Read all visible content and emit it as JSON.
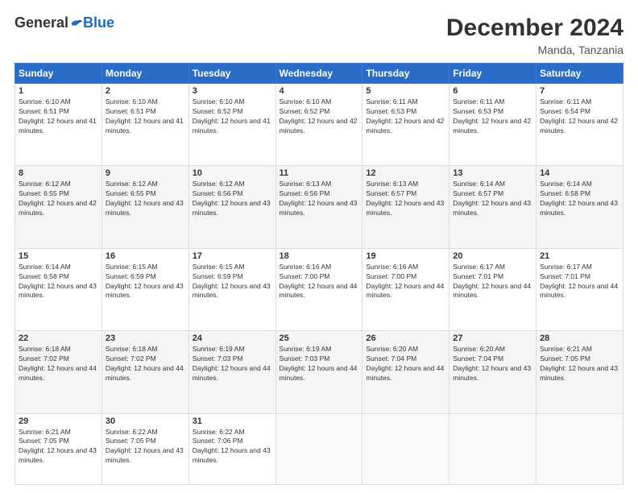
{
  "header": {
    "logo_general": "General",
    "logo_blue": "Blue",
    "month": "December 2024",
    "location": "Manda, Tanzania"
  },
  "weekdays": [
    "Sunday",
    "Monday",
    "Tuesday",
    "Wednesday",
    "Thursday",
    "Friday",
    "Saturday"
  ],
  "weeks": [
    [
      {
        "day": "1",
        "sunrise": "6:10 AM",
        "sunset": "6:51 PM",
        "daylight": "12 hours and 41 minutes."
      },
      {
        "day": "2",
        "sunrise": "6:10 AM",
        "sunset": "6:51 PM",
        "daylight": "12 hours and 41 minutes."
      },
      {
        "day": "3",
        "sunrise": "6:10 AM",
        "sunset": "6:52 PM",
        "daylight": "12 hours and 41 minutes."
      },
      {
        "day": "4",
        "sunrise": "6:10 AM",
        "sunset": "6:52 PM",
        "daylight": "12 hours and 42 minutes."
      },
      {
        "day": "5",
        "sunrise": "6:11 AM",
        "sunset": "6:53 PM",
        "daylight": "12 hours and 42 minutes."
      },
      {
        "day": "6",
        "sunrise": "6:11 AM",
        "sunset": "6:53 PM",
        "daylight": "12 hours and 42 minutes."
      },
      {
        "day": "7",
        "sunrise": "6:11 AM",
        "sunset": "6:54 PM",
        "daylight": "12 hours and 42 minutes."
      }
    ],
    [
      {
        "day": "8",
        "sunrise": "6:12 AM",
        "sunset": "6:55 PM",
        "daylight": "12 hours and 42 minutes."
      },
      {
        "day": "9",
        "sunrise": "6:12 AM",
        "sunset": "6:55 PM",
        "daylight": "12 hours and 43 minutes."
      },
      {
        "day": "10",
        "sunrise": "6:12 AM",
        "sunset": "6:56 PM",
        "daylight": "12 hours and 43 minutes."
      },
      {
        "day": "11",
        "sunrise": "6:13 AM",
        "sunset": "6:56 PM",
        "daylight": "12 hours and 43 minutes."
      },
      {
        "day": "12",
        "sunrise": "6:13 AM",
        "sunset": "6:57 PM",
        "daylight": "12 hours and 43 minutes."
      },
      {
        "day": "13",
        "sunrise": "6:14 AM",
        "sunset": "6:57 PM",
        "daylight": "12 hours and 43 minutes."
      },
      {
        "day": "14",
        "sunrise": "6:14 AM",
        "sunset": "6:58 PM",
        "daylight": "12 hours and 43 minutes."
      }
    ],
    [
      {
        "day": "15",
        "sunrise": "6:14 AM",
        "sunset": "6:58 PM",
        "daylight": "12 hours and 43 minutes."
      },
      {
        "day": "16",
        "sunrise": "6:15 AM",
        "sunset": "6:59 PM",
        "daylight": "12 hours and 43 minutes."
      },
      {
        "day": "17",
        "sunrise": "6:15 AM",
        "sunset": "6:59 PM",
        "daylight": "12 hours and 43 minutes."
      },
      {
        "day": "18",
        "sunrise": "6:16 AM",
        "sunset": "7:00 PM",
        "daylight": "12 hours and 44 minutes."
      },
      {
        "day": "19",
        "sunrise": "6:16 AM",
        "sunset": "7:00 PM",
        "daylight": "12 hours and 44 minutes."
      },
      {
        "day": "20",
        "sunrise": "6:17 AM",
        "sunset": "7:01 PM",
        "daylight": "12 hours and 44 minutes."
      },
      {
        "day": "21",
        "sunrise": "6:17 AM",
        "sunset": "7:01 PM",
        "daylight": "12 hours and 44 minutes."
      }
    ],
    [
      {
        "day": "22",
        "sunrise": "6:18 AM",
        "sunset": "7:02 PM",
        "daylight": "12 hours and 44 minutes."
      },
      {
        "day": "23",
        "sunrise": "6:18 AM",
        "sunset": "7:02 PM",
        "daylight": "12 hours and 44 minutes."
      },
      {
        "day": "24",
        "sunrise": "6:19 AM",
        "sunset": "7:03 PM",
        "daylight": "12 hours and 44 minutes."
      },
      {
        "day": "25",
        "sunrise": "6:19 AM",
        "sunset": "7:03 PM",
        "daylight": "12 hours and 44 minutes."
      },
      {
        "day": "26",
        "sunrise": "6:20 AM",
        "sunset": "7:04 PM",
        "daylight": "12 hours and 44 minutes."
      },
      {
        "day": "27",
        "sunrise": "6:20 AM",
        "sunset": "7:04 PM",
        "daylight": "12 hours and 43 minutes."
      },
      {
        "day": "28",
        "sunrise": "6:21 AM",
        "sunset": "7:05 PM",
        "daylight": "12 hours and 43 minutes."
      }
    ],
    [
      {
        "day": "29",
        "sunrise": "6:21 AM",
        "sunset": "7:05 PM",
        "daylight": "12 hours and 43 minutes."
      },
      {
        "day": "30",
        "sunrise": "6:22 AM",
        "sunset": "7:05 PM",
        "daylight": "12 hours and 43 minutes."
      },
      {
        "day": "31",
        "sunrise": "6:22 AM",
        "sunset": "7:06 PM",
        "daylight": "12 hours and 43 minutes."
      },
      null,
      null,
      null,
      null
    ]
  ]
}
